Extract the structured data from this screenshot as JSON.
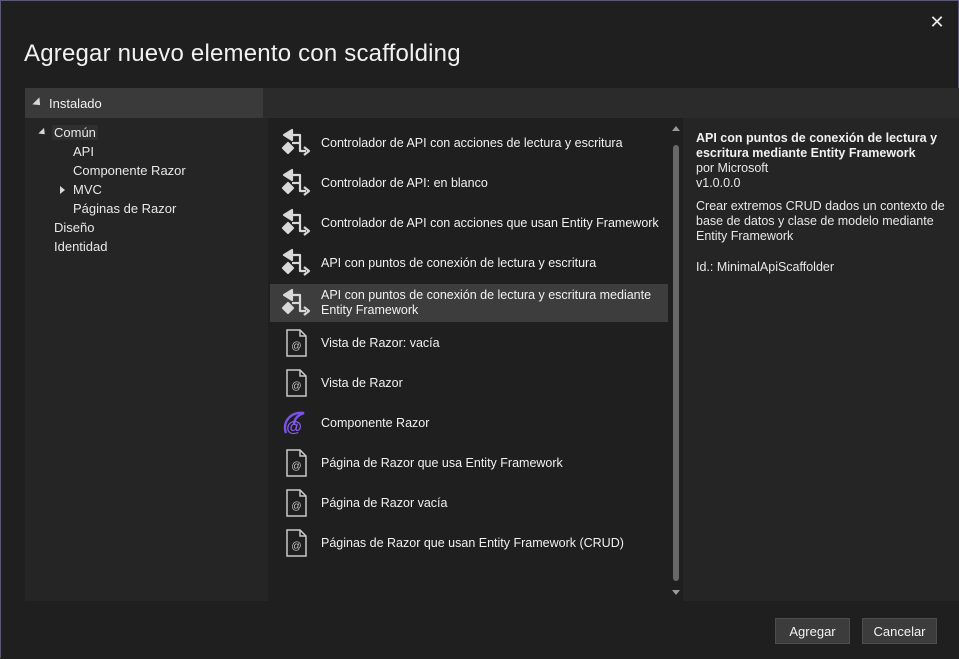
{
  "dialog": {
    "title": "Agregar nuevo elemento con scaffolding",
    "close_glyph": "✕"
  },
  "tree": {
    "header": "Instalado",
    "items": [
      {
        "label": "Común"
      },
      {
        "label": "API"
      },
      {
        "label": "Componente Razor"
      },
      {
        "label": "MVC"
      },
      {
        "label": "Páginas de Razor"
      },
      {
        "label": "Diseño"
      },
      {
        "label": "Identidad"
      }
    ]
  },
  "templates": [
    {
      "label": "Controlador de API con acciones de lectura y escritura",
      "icon": "api-controller-icon"
    },
    {
      "label": "Controlador de API: en blanco",
      "icon": "api-controller-icon"
    },
    {
      "label": "Controlador de API con acciones que usan Entity Framework",
      "icon": "api-controller-icon"
    },
    {
      "label": "API con puntos de conexión de lectura y escritura",
      "icon": "api-controller-icon"
    },
    {
      "label": "API con puntos de conexión de lectura y escritura mediante Entity Framework",
      "icon": "api-controller-icon",
      "selected": true
    },
    {
      "label": "Vista de Razor: vacía",
      "icon": "razor-file-icon"
    },
    {
      "label": "Vista de Razor",
      "icon": "razor-file-icon"
    },
    {
      "label": "Componente Razor",
      "icon": "blazor-component-icon"
    },
    {
      "label": "Página de Razor que usa Entity Framework",
      "icon": "razor-file-icon"
    },
    {
      "label": "Página de Razor vacía",
      "icon": "razor-file-icon"
    },
    {
      "label": "Páginas de Razor que usan Entity Framework (CRUD)",
      "icon": "razor-file-icon"
    }
  ],
  "details": {
    "title": "API con puntos de conexión de lectura y escritura mediante Entity Framework",
    "author": "por Microsoft",
    "version": "v1.0.0.0",
    "description": "Crear extremos CRUD dados un contexto de base de datos y clase de modelo mediante Entity Framework",
    "id": "Id.: MinimalApiScaffolder"
  },
  "buttons": {
    "add": "Agregar",
    "cancel": "Cancelar"
  },
  "colors": {
    "background": "#1f1f1f",
    "panel": "#252526",
    "selection": "#3d3d3d",
    "blazor_accent": "#6a3fd8"
  }
}
